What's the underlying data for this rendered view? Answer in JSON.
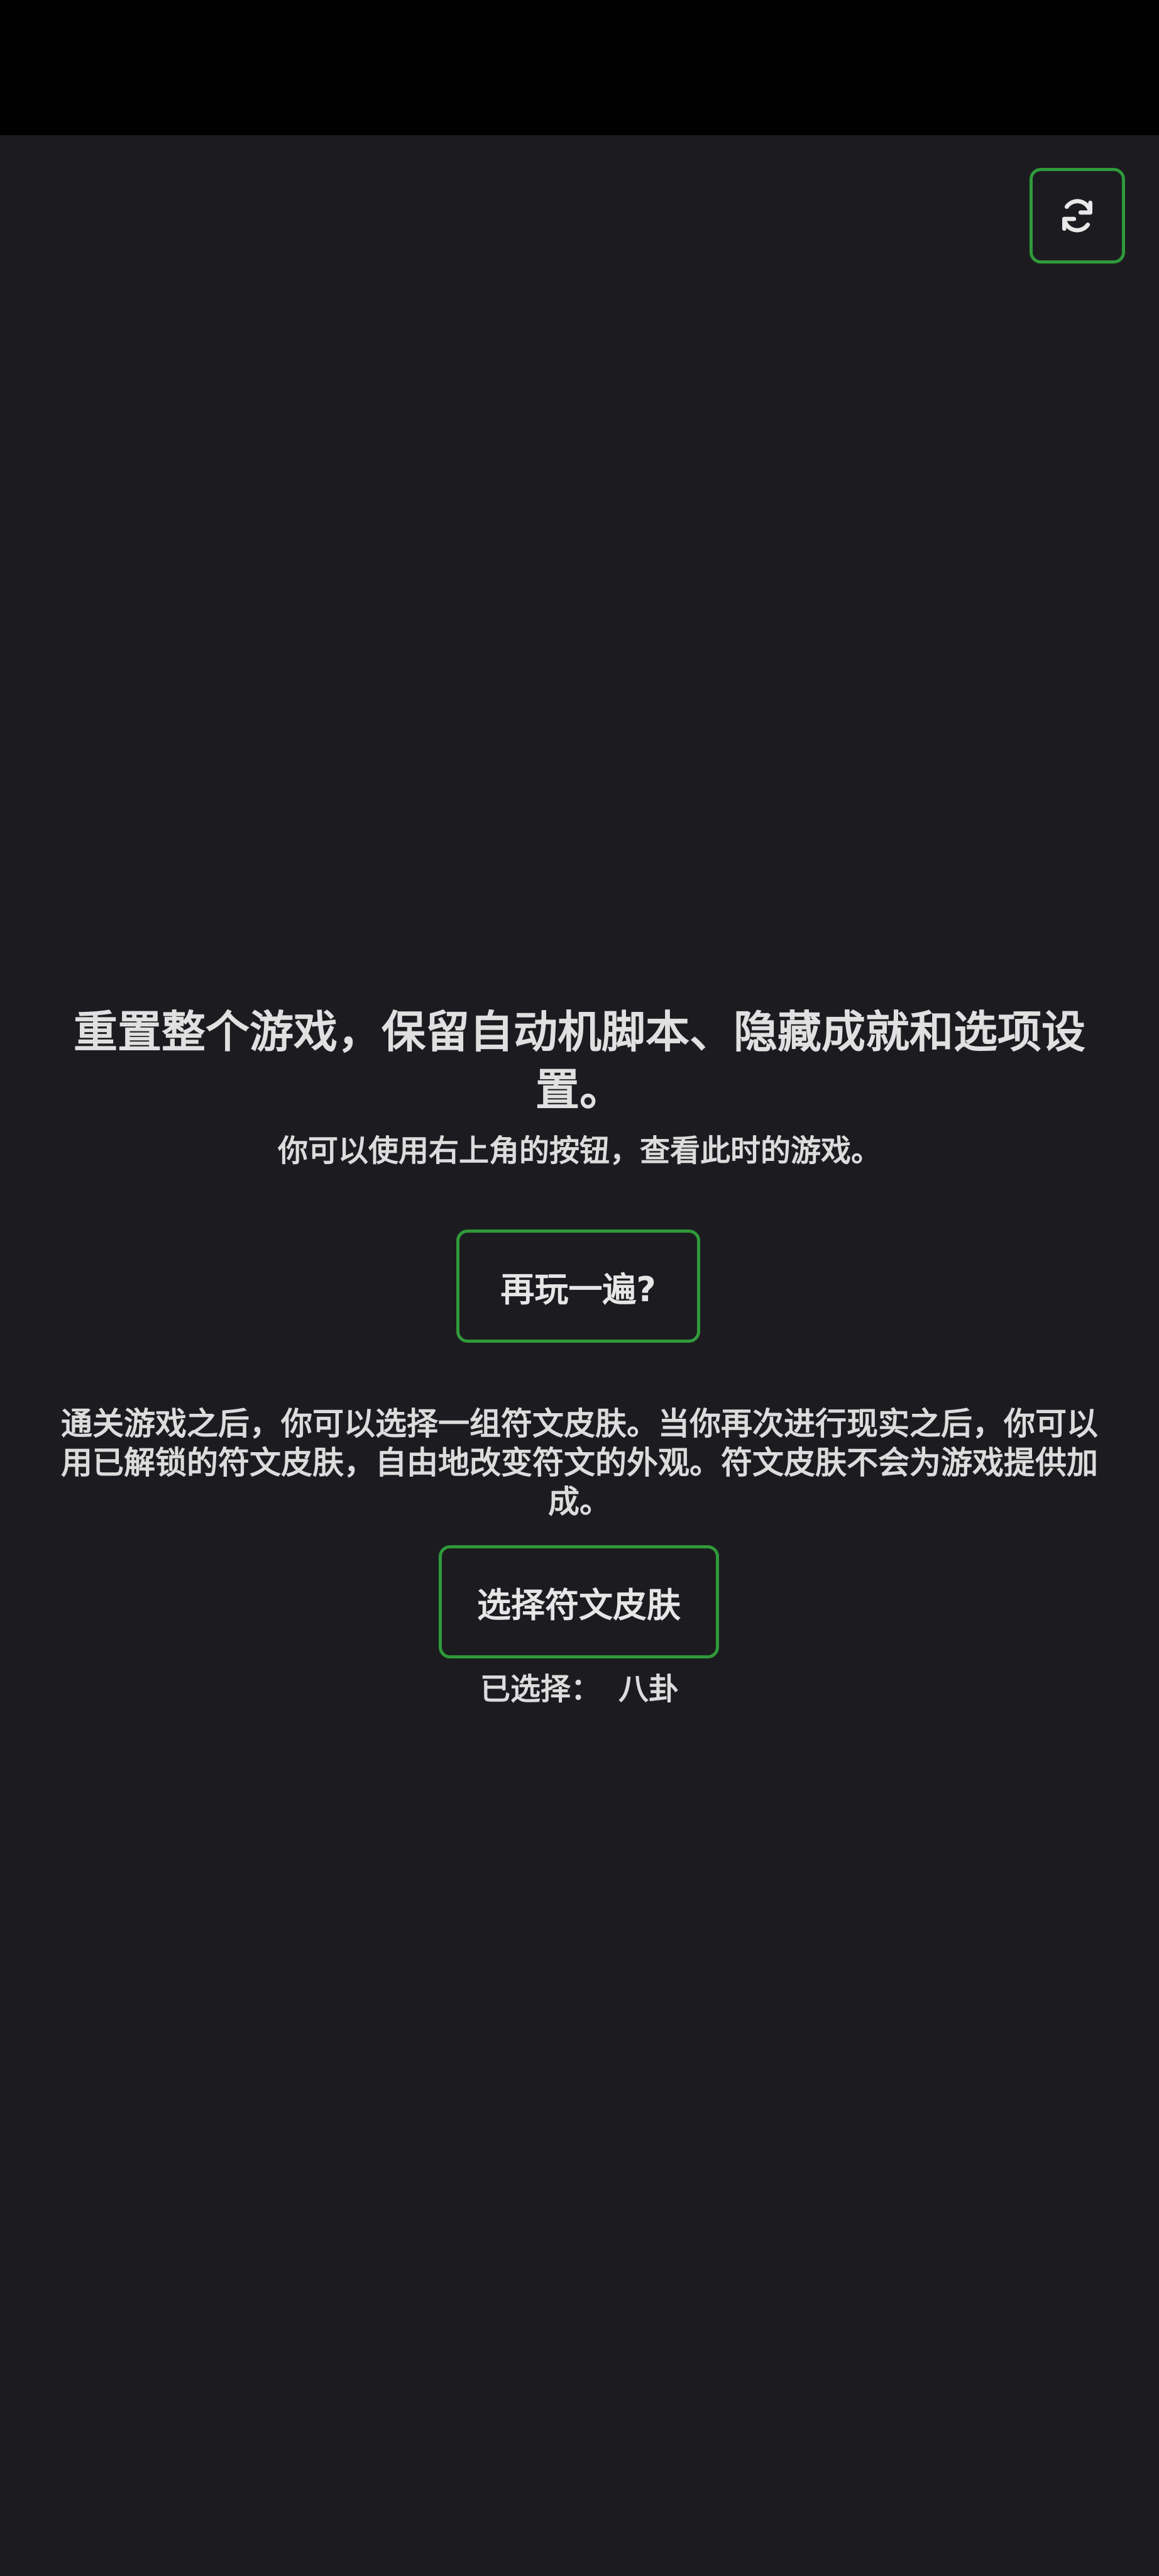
{
  "header": {
    "refresh_icon": "refresh-icon"
  },
  "main": {
    "title": "重置整个游戏，保留自动机脚本、隐藏成就和选项设置。",
    "subtitle": "你可以使用右上角的按钮，查看此时的游戏。",
    "play_again_label": "再玩一遍?",
    "description": "通关游戏之后，你可以选择一组符文皮肤。当你再次进行现实之后，你可以用已解锁的符文皮肤，自由地改变符文的外观。符文皮肤不会为游戏提供加成。",
    "choose_skin_label": "选择符文皮肤",
    "selected_label": "已选择：",
    "selected_value": "八卦"
  },
  "colors": {
    "background": "#1c1c20",
    "status_bar": "#000000",
    "accent_border": "#2f9a3a",
    "text": "#e6e6e6"
  }
}
